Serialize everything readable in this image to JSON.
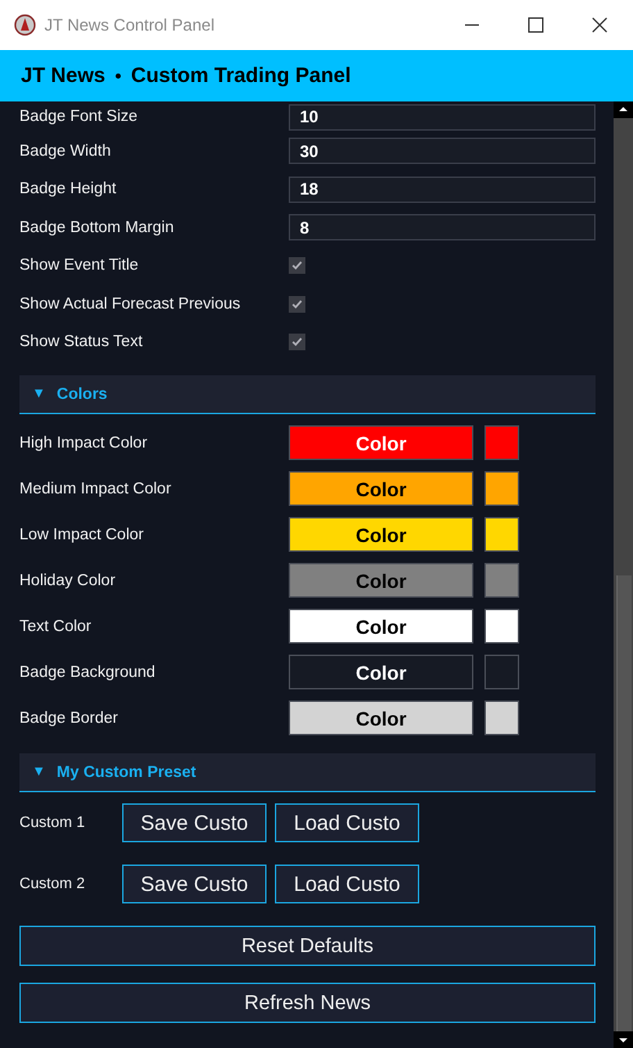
{
  "window": {
    "title": "JT News Control Panel"
  },
  "header": {
    "brand": "JT News",
    "separator": "•",
    "subtitle": "Custom Trading Panel"
  },
  "settings": [
    {
      "kind": "field",
      "label": "Badge Font Size",
      "value": "10"
    },
    {
      "kind": "field",
      "label": "Badge Width",
      "value": "30"
    },
    {
      "kind": "field",
      "label": "Badge Height",
      "value": "18"
    },
    {
      "kind": "field",
      "label": "Badge Bottom Margin",
      "value": "8"
    },
    {
      "kind": "checkbox",
      "label": "Show Event Title",
      "checked": true
    },
    {
      "kind": "checkbox",
      "label": "Show Actual Forecast Previous",
      "checked": true
    },
    {
      "kind": "checkbox",
      "label": "Show Status Text",
      "checked": true
    }
  ],
  "colors_section": {
    "arrow": "▼",
    "title": "Colors",
    "expanded": true,
    "rows": [
      {
        "label": "High Impact Color",
        "button": "Color",
        "color": "#ff0000"
      },
      {
        "label": "Medium Impact Color",
        "button": "Color",
        "color": "#ffa500"
      },
      {
        "label": "Low Impact Color",
        "button": "Color",
        "color": "#ffd700"
      },
      {
        "label": "Holiday Color",
        "button": "Color",
        "color": "#808080"
      },
      {
        "label": "Text Color",
        "button": "Color",
        "color": "#ffffff"
      },
      {
        "label": "Badge Background",
        "button": "Color",
        "color": "#161a24"
      },
      {
        "label": "Badge Border",
        "button": "Color",
        "color": "#d3d3d3"
      }
    ]
  },
  "preset_section": {
    "arrow": "▼",
    "title": "My Custom Preset",
    "expanded": true,
    "rows": [
      {
        "label": "Custom 1",
        "save": "Save Custo",
        "load": "Load Custo"
      },
      {
        "label": "Custom 2",
        "save": "Save Custo",
        "load": "Load Custo"
      }
    ]
  },
  "actions": [
    "Reset Defaults",
    "Refresh News"
  ]
}
